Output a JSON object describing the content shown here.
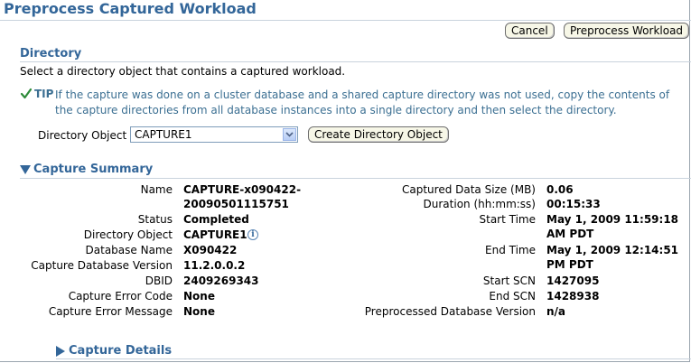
{
  "page": {
    "title": "Preprocess Captured Workload"
  },
  "toolbar": {
    "cancel_label": "Cancel",
    "preprocess_label": "Preprocess Workload"
  },
  "directory": {
    "header": "Directory",
    "instruction": "Select a directory object that contains a captured workload.",
    "tip_label": "TIP",
    "tip_text": "If the capture was done on a cluster database and a shared capture directory was not used, copy the contents of the capture directories from all database instances into a single directory and then select the directory.",
    "object_label": "Directory Object",
    "object_value": "CAPTURE1",
    "create_button": "Create Directory Object"
  },
  "summary": {
    "header": "Capture Summary",
    "left": [
      {
        "label": "Name",
        "value": "CAPTURE-x090422-",
        "value2": "20090501115751"
      },
      {
        "label": "Status",
        "value": "Completed"
      },
      {
        "label": "Directory Object",
        "value": "CAPTURE1"
      },
      {
        "label": "Database Name",
        "value": "X090422"
      },
      {
        "label": "Capture Database Version",
        "value": "11.2.0.0.2"
      },
      {
        "label": "DBID",
        "value": "2409269343"
      },
      {
        "label": "Capture Error Code",
        "value": "None"
      },
      {
        "label": "Capture Error Message",
        "value": "None"
      }
    ],
    "right": [
      {
        "label": "Captured Data Size (MB)",
        "value": "0.06"
      },
      {
        "label": "Duration (hh:mm:ss)",
        "value": "00:15:33"
      },
      {
        "label": "Start Time",
        "value": "May 1, 2009 11:59:18",
        "value2": "AM PDT"
      },
      {
        "label": "End Time",
        "value": "May 1, 2009 12:14:51",
        "value2": "PM PDT"
      },
      {
        "label": "Start SCN",
        "value": "1427095"
      },
      {
        "label": "End SCN",
        "value": "1428938"
      },
      {
        "label": "Preprocessed Database Version",
        "value": "n/a"
      }
    ]
  },
  "details": {
    "header": "Capture Details"
  },
  "colors": {
    "accent": "#336699",
    "tip": "#3b6f92",
    "button_bg": "#f7f7e7"
  },
  "icons": {
    "tip": "checkmark-icon",
    "info": "info-icon",
    "expanded": "triangle-down-icon",
    "collapsed": "triangle-right-icon",
    "dropdown": "chevron-down-icon"
  }
}
